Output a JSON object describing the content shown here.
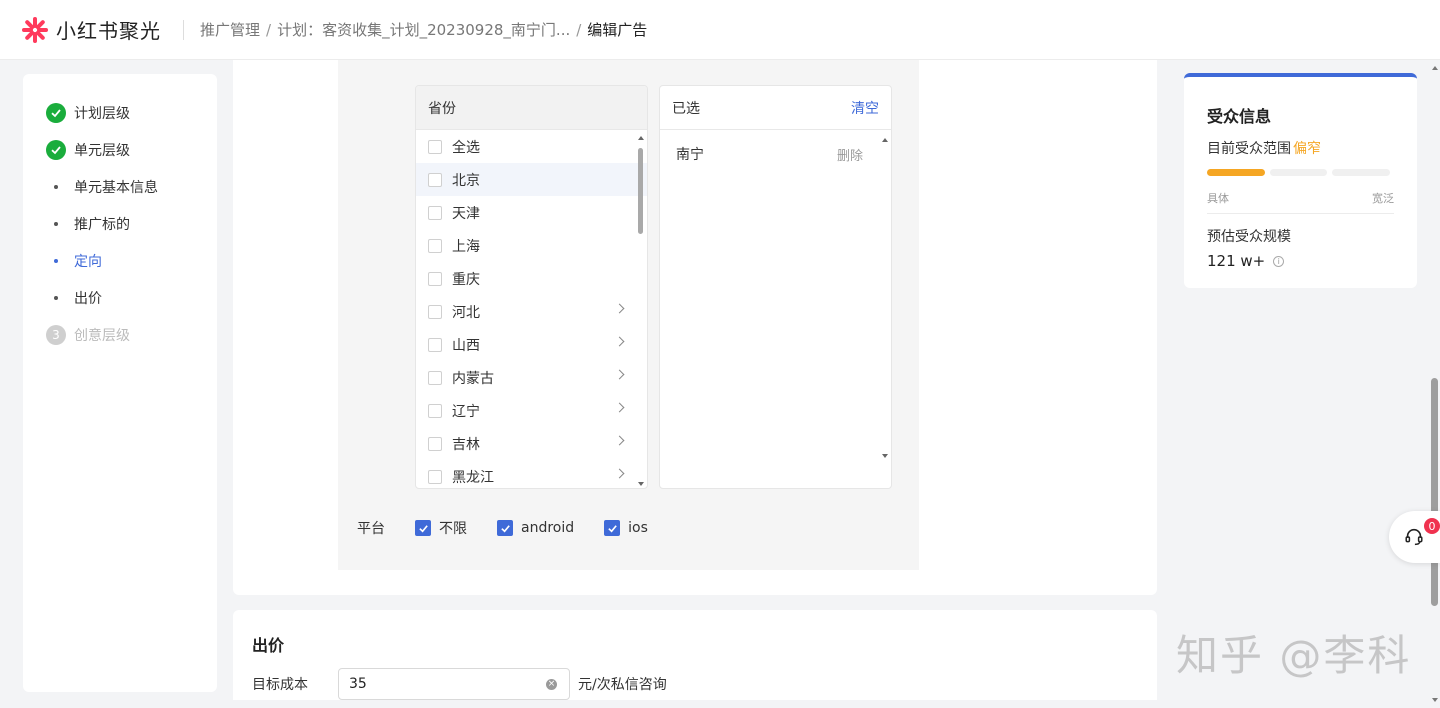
{
  "header": {
    "logo_text": "小红书聚光",
    "breadcrumb": [
      "推广管理",
      "计划：客资收集_计划_20230928_南宁门..."
    ],
    "breadcrumb_current": "编辑广告",
    "separator": "/"
  },
  "leftnav": {
    "items": [
      {
        "label": "计划层级",
        "state": "done"
      },
      {
        "label": "单元层级",
        "state": "done"
      },
      {
        "label": "单元基本信息",
        "state": "sub"
      },
      {
        "label": "推广标的",
        "state": "sub"
      },
      {
        "label": "定向",
        "state": "active"
      },
      {
        "label": "出价",
        "state": "sub"
      },
      {
        "label": "创意层级",
        "state": "disabled",
        "number": "3"
      }
    ]
  },
  "province_panel": {
    "title": "省份",
    "items": [
      {
        "label": "全选",
        "has_children": false
      },
      {
        "label": "北京",
        "has_children": false
      },
      {
        "label": "天津",
        "has_children": false
      },
      {
        "label": "上海",
        "has_children": false
      },
      {
        "label": "重庆",
        "has_children": false
      },
      {
        "label": "河北",
        "has_children": true
      },
      {
        "label": "山西",
        "has_children": true
      },
      {
        "label": "内蒙古",
        "has_children": true
      },
      {
        "label": "辽宁",
        "has_children": true
      },
      {
        "label": "吉林",
        "has_children": true
      },
      {
        "label": "黑龙江",
        "has_children": true
      }
    ]
  },
  "selected_panel": {
    "title": "已选",
    "clear_label": "清空",
    "items": [
      {
        "label": "南宁",
        "delete_label": "删除"
      }
    ]
  },
  "platform": {
    "label": "平台",
    "options": [
      {
        "label": "不限",
        "checked": true
      },
      {
        "label": "android",
        "checked": true
      },
      {
        "label": "ios",
        "checked": true
      }
    ]
  },
  "bid": {
    "title": "出价",
    "target_cost_label": "目标成本",
    "target_cost_value": "35",
    "unit": "元/次私信咨询"
  },
  "audience": {
    "title": "受众信息",
    "range_label": "目前受众范围",
    "range_value": "偏窄",
    "range_level": 1,
    "range_levels_total": 3,
    "left_end": "具体",
    "right_end": "宽泛",
    "estimate_label": "预估受众规模",
    "estimate_value": "121 w+"
  },
  "support": {
    "badge": "0"
  },
  "watermark": "知乎 @李科",
  "colors": {
    "primary": "#3f6ad8",
    "success": "#1aad3c",
    "warning": "#f5a623",
    "brand": "#ff3a5c"
  }
}
